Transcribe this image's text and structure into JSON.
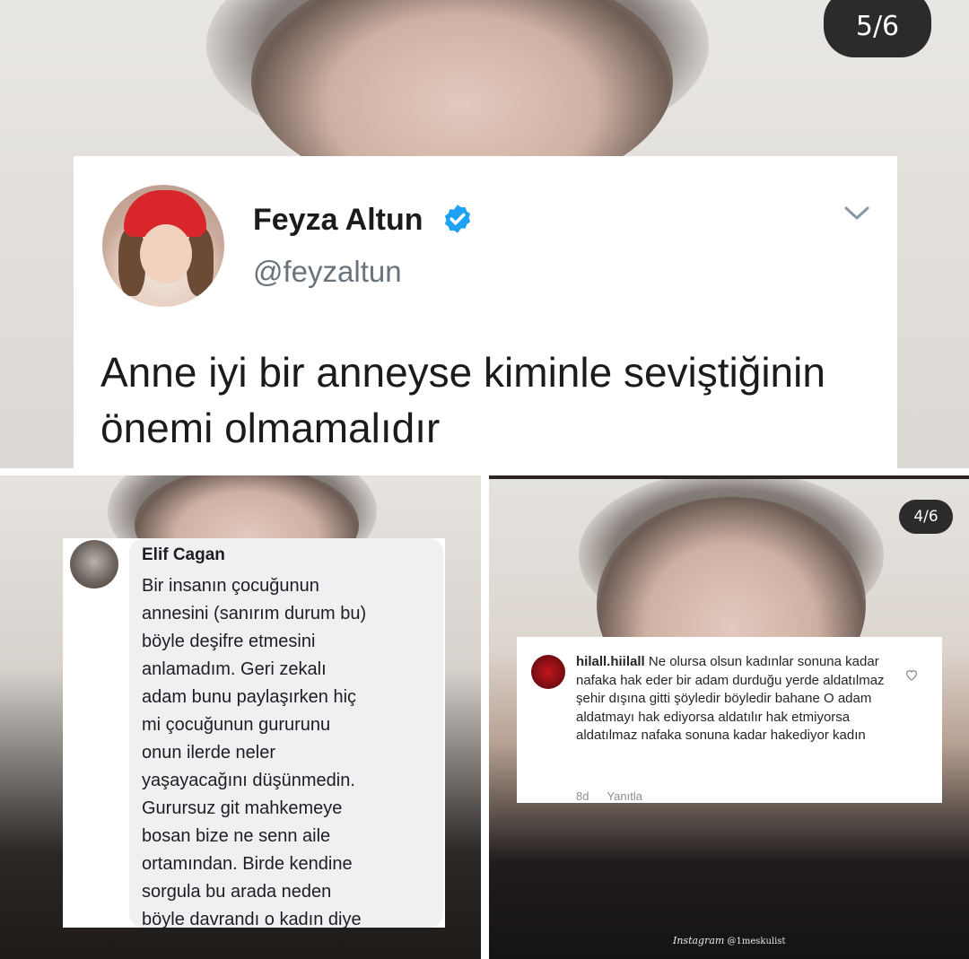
{
  "top": {
    "counter": "5/6",
    "tweet": {
      "name": "Feyza Altun",
      "handle": "@feyzaltun",
      "verified": true,
      "text": "Anne iyi bir anneyse kiminle seviştiğinin önemi olmamalıdır"
    }
  },
  "bottom_left": {
    "comment": {
      "author": "Elif Cagan",
      "text": "Bir insanın çocuğunun\nannesini (sanırım durum bu)\nböyle deşifre  etmesini\nanlamadım.  Geri zekalı\nadam bunu paylaşırken hiç\nmi çocuğunun gururunu\nonun ilerde neler\nyaşayacağını düşünmedin.\nGurursuz git mahkemeye\nbosan bize ne senn aile\nortamından.  Birde kendine\nsorgula bu arada neden\nböyle davrandı o kadın diye"
    }
  },
  "bottom_right": {
    "counter": "4/6",
    "comment": {
      "username": "hilall.hiilall",
      "text": "Ne olursa olsun kadınlar sonuna kadar nafaka hak eder bir adam durduğu yerde aldatılmaz şehir dışına gitti şöyledir böyledir bahane O adam aldatmayı hak ediyorsa aldatılır hak etmiyorsa aldatılmaz nafaka  sonuna kadar hakediyor kadın",
      "time": "8d",
      "reply_label": "Yanıtla"
    },
    "watermark_brand": "Instagram",
    "watermark_handle": "@1meskulist"
  },
  "colors": {
    "verified": "#1da1f2",
    "counter_bg": "#2b2b2b",
    "bubble_bg": "#eef0f2"
  },
  "icons": [
    "verified-badge-icon",
    "chevron-down-icon",
    "heart-icon"
  ]
}
